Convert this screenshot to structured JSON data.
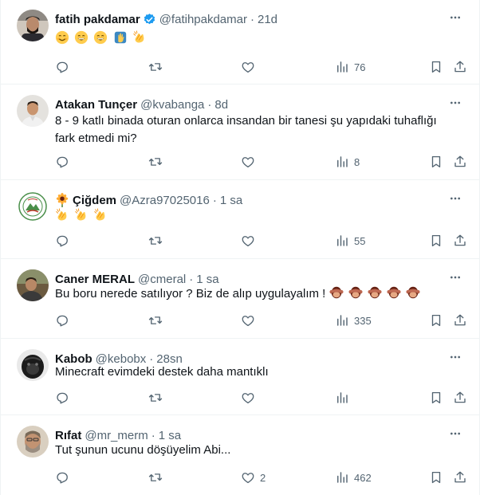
{
  "tweets": [
    {
      "name": "fatih pakdamar",
      "handle": "@fatihpakdamar",
      "time": "21d",
      "verified": true,
      "text": "",
      "emoji": [
        "smiling-face-icon",
        "grinning-face-icon",
        "grinning-face-icon",
        "raising-hand-icon",
        "clapping-hands-icon"
      ],
      "replies": "",
      "retweets": "",
      "likes": "",
      "views": "76"
    },
    {
      "name": "Atakan Tunçer",
      "handle": "@kvabanga",
      "time": "8d",
      "verified": false,
      "text": "8 - 9 katlı binada oturan onlarca insandan bir tanesi şu yapıdaki tuhaflığı fark etmedi mi?",
      "emoji": [],
      "replies": "",
      "retweets": "",
      "likes": "",
      "views": "8"
    },
    {
      "name": "Çiğdem",
      "name_emoji": "sunflower-icon",
      "handle": "@Azra97025016",
      "time": "1 sa",
      "verified": false,
      "text": "",
      "emoji": [
        "clapping-hands-icon",
        "clapping-hands-icon",
        "clapping-hands-icon"
      ],
      "replies": "",
      "retweets": "",
      "likes": "",
      "views": "55"
    },
    {
      "name": "Caner MERAL",
      "handle": "@cmeral",
      "time": "1 sa",
      "verified": false,
      "text": "Bu boru nerede satılıyor ? Biz de alıp uygulayalım !",
      "emoji": [
        "see-no-evil-monkey-icon",
        "see-no-evil-monkey-icon",
        "see-no-evil-monkey-icon",
        "see-no-evil-monkey-icon",
        "see-no-evil-monkey-icon"
      ],
      "replies": "",
      "retweets": "",
      "likes": "",
      "views": "335"
    },
    {
      "name": "Kabob",
      "handle": "@kebobx",
      "time": "28sn",
      "verified": false,
      "text": "Minecraft evimdeki destek daha mantıklı",
      "emoji": [],
      "replies": "",
      "retweets": "",
      "likes": "",
      "views": ""
    },
    {
      "name": "Rıfat",
      "handle": "@mr_merm",
      "time": "1 sa",
      "verified": false,
      "text": "Tut şunun ucunu döşüyelim Abi...",
      "emoji": [],
      "replies": "",
      "retweets": "",
      "likes": "2",
      "views": "462"
    }
  ],
  "sep": "·",
  "colors": {
    "secondary_text": "#536471",
    "verified_blue": "#1d9bf0",
    "divider": "#eff3f4"
  }
}
